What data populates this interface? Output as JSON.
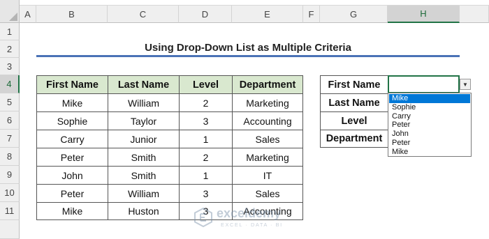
{
  "columns": [
    "A",
    "B",
    "C",
    "D",
    "E",
    "F",
    "G",
    "H"
  ],
  "selected_column": "H",
  "rows": [
    "1",
    "2",
    "3",
    "4",
    "5",
    "6",
    "7",
    "8",
    "9",
    "10",
    "11"
  ],
  "selected_row": "4",
  "title": "Using Drop-Down List as Multiple Criteria",
  "table": {
    "headers": [
      "First Name",
      "Last Name",
      "Level",
      "Department"
    ],
    "rows": [
      [
        "Mike",
        "William",
        "2",
        "Marketing"
      ],
      [
        "Sophie",
        "Taylor",
        "3",
        "Accounting"
      ],
      [
        "Carry",
        "Junior",
        "1",
        "Sales"
      ],
      [
        "Peter",
        "Smith",
        "2",
        "Marketing"
      ],
      [
        "John",
        "Smith",
        "1",
        "IT"
      ],
      [
        "Peter",
        "William",
        "3",
        "Sales"
      ],
      [
        "Mike",
        "Huston",
        "3",
        "Accounting"
      ]
    ]
  },
  "criteria": {
    "labels": [
      "First Name",
      "Last Name",
      "Level",
      "Department"
    ],
    "first_name_value": ""
  },
  "dropdown": {
    "options": [
      "Mike",
      "Sophie",
      "Carry",
      "Peter",
      "John",
      "Peter",
      "Mike"
    ],
    "highlighted_index": 0
  },
  "watermark": {
    "name": "exceldemy",
    "tagline": "EXCEL · DATA · BI"
  },
  "colors": {
    "header_fill": "#d9e8cf",
    "title_underline": "#4a72b6",
    "selection": "#217346",
    "highlight": "#0078d7"
  }
}
